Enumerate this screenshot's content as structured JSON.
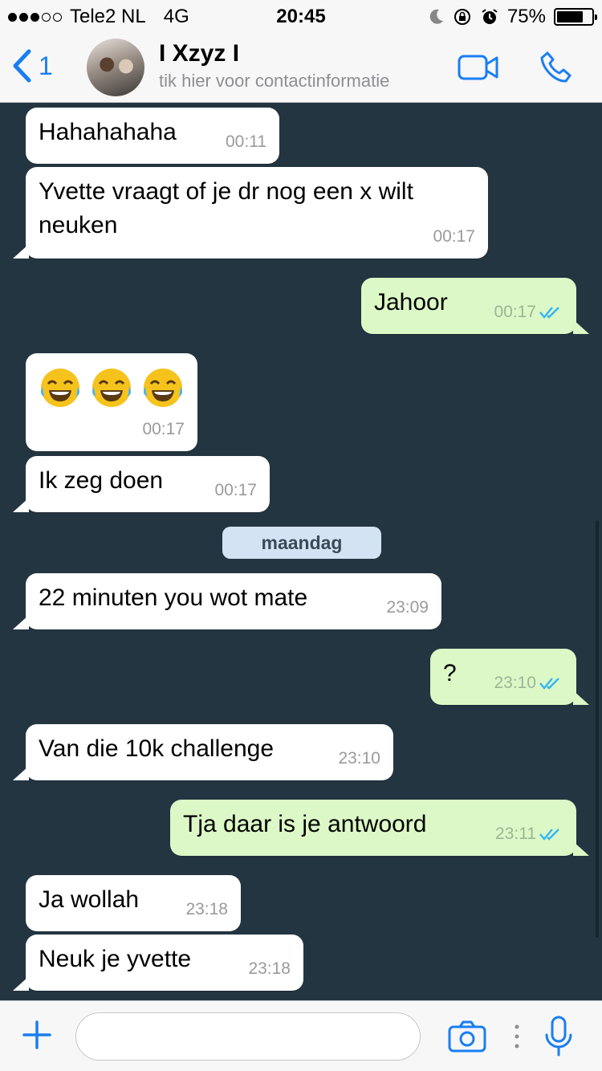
{
  "status": {
    "carrier": "Tele2 NL",
    "network": "4G",
    "time": "20:45",
    "battery": "75%",
    "battery_level": 0.75
  },
  "header": {
    "back_count": "1",
    "contact_name": "I Xzyz I",
    "contact_subtitle": "tik hier voor contactinformatie"
  },
  "messages": [
    {
      "dir": "in",
      "text": "Hahahahaha",
      "time": "00:11"
    },
    {
      "dir": "in",
      "text": "Yvette vraagt of je dr nog een x wilt neuken",
      "time": "00:17"
    },
    {
      "dir": "out",
      "text": "Jahoor",
      "time": "00:17"
    },
    {
      "dir": "in",
      "text": "😂😂😂",
      "time": "00:17"
    },
    {
      "dir": "in",
      "text": "Ik zeg doen",
      "time": "00:17"
    },
    {
      "dir": "in",
      "text": "22 minuten you wot mate",
      "time": "23:09"
    },
    {
      "dir": "out",
      "text": "?",
      "time": "23:10"
    },
    {
      "dir": "in",
      "text": "Van die 10k challenge",
      "time": "23:10"
    },
    {
      "dir": "out",
      "text": "Tja daar is je antwoord",
      "time": "23:11"
    },
    {
      "dir": "in",
      "text": "Ja wollah",
      "time": "23:18"
    },
    {
      "dir": "in",
      "text": "Neuk je yvette",
      "time": "23:18"
    }
  ],
  "day_separator": "maandag",
  "input": {
    "value": "",
    "placeholder": ""
  },
  "colors": {
    "accent": "#1a7ef2",
    "chat_bg": "#233540",
    "incoming": "#ffffff",
    "outgoing": "#dcf8c6",
    "read_ticks": "#34b7f1"
  },
  "icons": [
    "back-chevron-icon",
    "video-call-icon",
    "phone-icon",
    "plus-icon",
    "camera-icon",
    "more-dots-icon",
    "microphone-icon",
    "read-ticks-icon",
    "moon-icon",
    "lock-rotation-icon",
    "alarm-icon",
    "battery-icon"
  ]
}
